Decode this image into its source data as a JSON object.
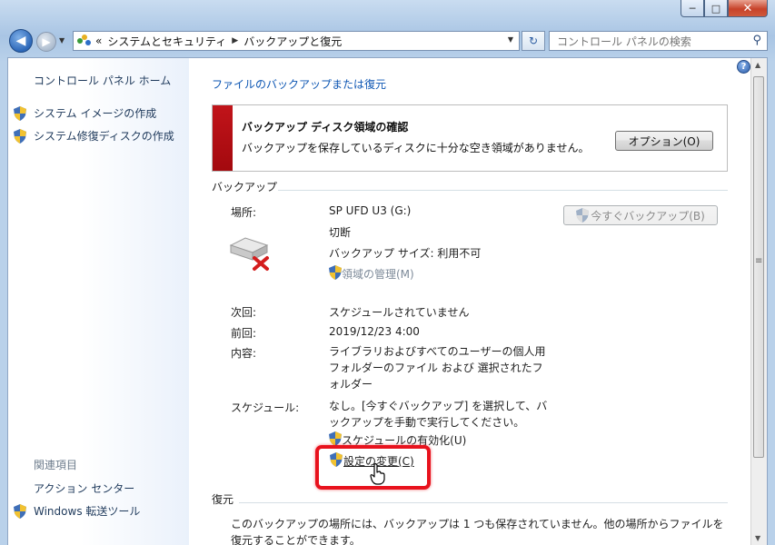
{
  "window": {
    "caption_buttons": {
      "minimize": "─",
      "maximize": "□",
      "close": "✕"
    }
  },
  "nav": {
    "breadcrumbs": [
      "システムとセキュリティ",
      "バックアップと復元"
    ],
    "overflow": "«",
    "search_placeholder": "コントロール パネルの検索"
  },
  "sidebar": {
    "home": "コントロール パネル ホーム",
    "tasks": [
      "システム イメージの作成",
      "システム修復ディスクの作成"
    ],
    "related_title": "関連項目",
    "related": [
      "アクション センター",
      "Windows 転送ツール"
    ]
  },
  "main": {
    "title_link": "ファイルのバックアップまたは復元",
    "warning": {
      "title": "バックアップ ディスク領域の確認",
      "description": "バックアップを保存しているディスクに十分な空き領域がありません。",
      "options_button": "オプション(O)",
      "accent_color": "#b30e14"
    },
    "backup": {
      "section_title": "バックアップ",
      "location_label": "場所:",
      "drive_name": "SP UFD U3 (G:)",
      "drive_status": "切断",
      "backup_size": "バックアップ サイズ: 利用不可",
      "manage_space_link": "領域の管理(M)",
      "backup_now_button": "今すぐバックアップ(B)",
      "next_label": "次回:",
      "next_value": "スケジュールされていません",
      "last_label": "前回:",
      "last_value": "2019/12/23 4:00",
      "contents_label": "内容:",
      "contents_value": [
        "ライブラリおよびすべてのユーザーの個人用",
        "フォルダーのファイル および 選択されたフ",
        "ォルダー"
      ],
      "schedule_label": "スケジュール:",
      "schedule_value": [
        "なし。[今すぐバックアップ] を選択して、バ",
        "ックアップを手動で実行してください。"
      ],
      "enable_schedule_link": "スケジュールの有効化(U)",
      "change_settings_link": "設定の変更(C)"
    },
    "restore": {
      "section_title": "復元",
      "description": [
        "このバックアップの場所には、バックアップは 1 つも保存されていません。他の場所からファイルを",
        "復元することができます。"
      ]
    }
  },
  "colors": {
    "link": "#0d56b3",
    "highlight": "#e8121d"
  }
}
